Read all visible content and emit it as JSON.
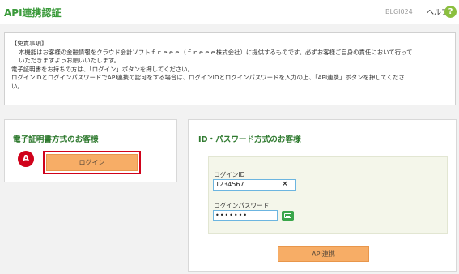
{
  "header": {
    "title": "API連携認証",
    "screen_id": "BLGI024",
    "help_label": "ヘルプ",
    "help_icon_glyph": "?"
  },
  "disclaimer": {
    "heading": "【免責事項】",
    "line1": "本機能はお客様の金融情報をクラウド会計ソフトｆｒｅｅｅ（ｆｒｅｅｅ株式会社）に提供するものです。必ずお客様ご自身の責任において行って",
    "line2": "いただきますようお願いいたします。",
    "line3": "電子証明書をお持ちの方は、「ログイン」ボタンを押してください。",
    "line4": "ログインIDとログインパスワードでAPI連携の認可をする場合は、ログインIDとログインパスワードを入力の上、「API連携」ボタンを押してくださ",
    "line5": "い。"
  },
  "certificate_panel": {
    "title": "電子証明書方式のお客様",
    "marker_label": "A",
    "login_button": "ログイン"
  },
  "password_panel": {
    "title": "ID・パスワード方式のお客様",
    "login_id_label": "ログインID",
    "login_id_value": "1234567",
    "password_label": "ログインパスワード",
    "password_value": "•••••••",
    "api_button": "API連携"
  },
  "colors": {
    "accent_green": "#3a9a3a",
    "button_orange": "#f7ad66",
    "marker_red": "#d0021b"
  }
}
